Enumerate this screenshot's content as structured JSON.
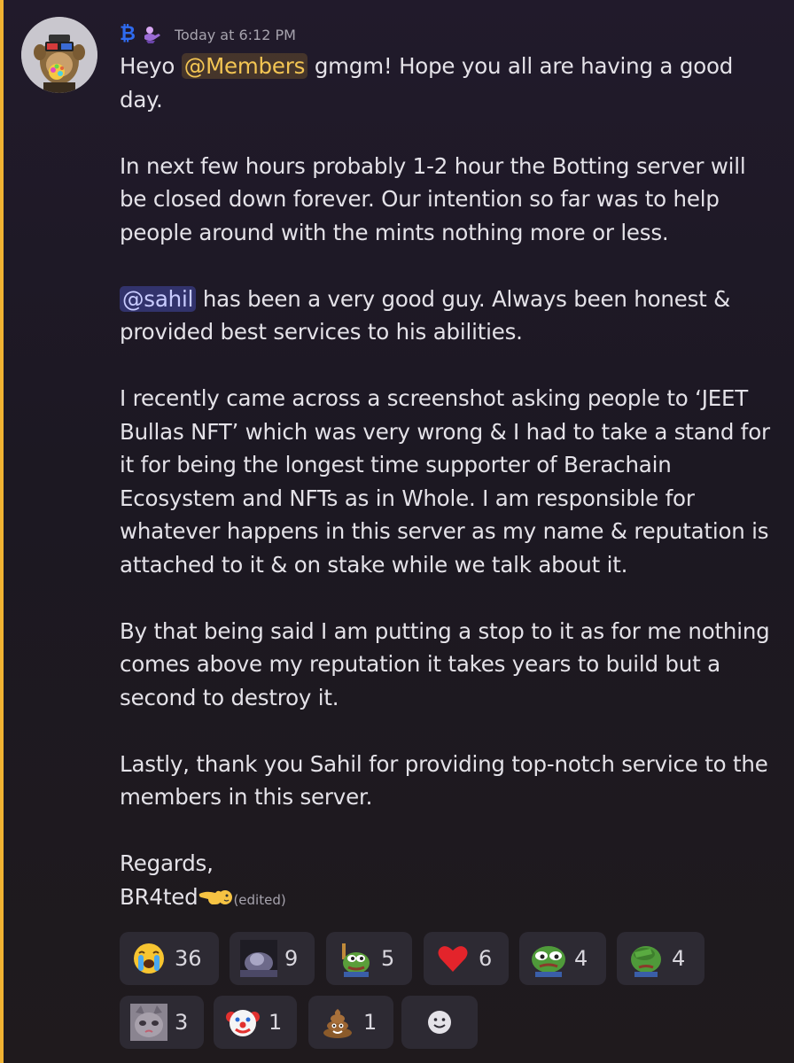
{
  "message": {
    "timestamp": "Today at 6:12 PM",
    "badge_glyph": "₿",
    "mention_members": "@Members",
    "mention_sahil": "@sahil",
    "line1_before": "Heyo ",
    "line1_after": " gmgm! Hope you all are having a good day.",
    "para2": "In next few hours probably 1-2 hour the Botting server will be closed down forever. Our intention so far was to help people around with the mints nothing more or less.",
    "para3_after": " has been a very good guy. Always been honest & provided best services to his abilities.",
    "para4": "I recently came across a screenshot asking people to ‘JEET Bullas NFT’ which was very wrong & I had to take a stand for it for being the longest time supporter of Berachain Ecosystem and NFTs as in Whole. I am responsible for whatever happens in this server as my name & reputation is attached to it & on stake while we talk about it.",
    "para5": "By that being said I am putting a stop to it as for me nothing comes above my reputation it takes years to build but a second to destroy it.",
    "para6": "Lastly, thank you Sahil for providing top-notch service to the members in this server.",
    "sign_regards": "Regards,",
    "sign_name": "BR4ted",
    "edited_label": "(edited)"
  },
  "reactions": [
    {
      "icon": "loudly-crying-face-icon",
      "glyph": "😭",
      "count": "36"
    },
    {
      "icon": "custom-blurry-emoji-icon",
      "glyph": "",
      "count": "9"
    },
    {
      "icon": "pepe-cheers-emoji-icon",
      "glyph": "",
      "count": "5"
    },
    {
      "icon": "red-heart-icon",
      "glyph": "❤",
      "count": "6"
    },
    {
      "icon": "pepe-sad-emoji-icon",
      "glyph": "",
      "count": "4"
    },
    {
      "icon": "pepe-facepalm-emoji-icon",
      "glyph": "",
      "count": "4"
    },
    {
      "icon": "crying-cat-emoji-icon",
      "glyph": "",
      "count": "3"
    },
    {
      "icon": "clown-face-icon",
      "glyph": "🤡",
      "count": "1"
    },
    {
      "icon": "pile-of-poo-icon",
      "glyph": "💩",
      "count": "1"
    },
    {
      "icon": "add-reaction-icon",
      "glyph": "",
      "count": ""
    }
  ],
  "colors": {
    "mention_highlight": "#f0b232",
    "role_mention_text": "#f3c553",
    "user_mention_bg": "#5865f2",
    "reaction_bg": "#2d2a33"
  }
}
